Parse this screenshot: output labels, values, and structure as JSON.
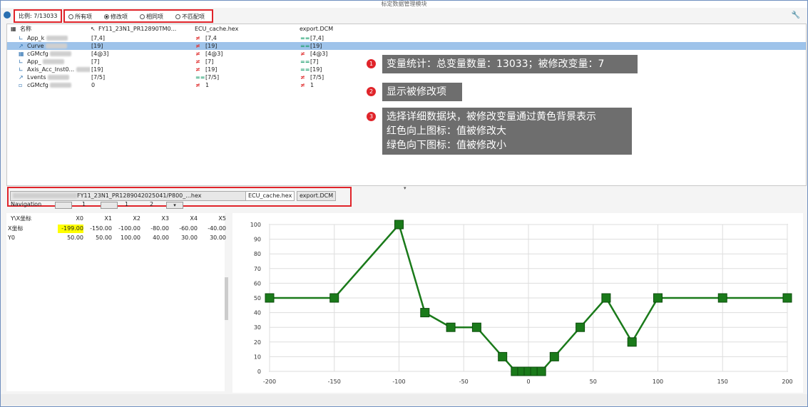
{
  "window": {
    "title": "标定数据管理模块"
  },
  "toolbar": {
    "ratio": "比例: 7/13033",
    "filters": [
      {
        "label": "所有项",
        "selected": false
      },
      {
        "label": "修改项",
        "selected": true
      },
      {
        "label": "相同项",
        "selected": false
      },
      {
        "label": "不匹配项",
        "selected": false
      }
    ],
    "settings_icon": "wrench-icon"
  },
  "tree": {
    "headers": [
      "名称",
      "FY11_23N1_PR12890TM0...",
      "ECU_cache.hex",
      "export.DCM"
    ],
    "rows": [
      {
        "icon": "axis-icon",
        "name": "App_k",
        "a": "[7,4]",
        "cmp1": "≠",
        "b": "[7,4",
        "cmp2": "==",
        "c": "[7,4]",
        "selected": false
      },
      {
        "icon": "curve-icon",
        "name": "Curve",
        "a": "[19]",
        "cmp1": "≠",
        "b": "[19]",
        "cmp2": "==",
        "c": "[19]",
        "selected": true
      },
      {
        "icon": "map-icon",
        "name": "cGMcfg",
        "a": "[4@3]",
        "cmp1": "≠",
        "b": "[4@3]",
        "cmp2": "≠",
        "c": "[4@3]",
        "selected": false
      },
      {
        "icon": "axis-icon",
        "name": "App_",
        "a": "[7]",
        "cmp1": "≠",
        "b": "[7]",
        "cmp2": "==",
        "c": "[7]",
        "selected": false
      },
      {
        "icon": "axis-icon",
        "name": "Axis_Acc_Inst0...",
        "a": "[19]",
        "cmp1": "≠",
        "b": "[19]",
        "cmp2": "==",
        "c": "[19]",
        "selected": false
      },
      {
        "icon": "curve-icon",
        "name": "Lvents",
        "a": "[7/5]",
        "cmp1": "==",
        "b": "[7/5]",
        "cmp2": "≠",
        "c": "[7/5]",
        "selected": false
      },
      {
        "icon": "value-icon",
        "name": "cGMcfg",
        "a": "0",
        "cmp1": "≠",
        "b": "1",
        "cmp2": "≠",
        "c": "1",
        "selected": false
      }
    ]
  },
  "callouts": [
    {
      "num": "1",
      "lines": [
        "变量统计：总变量数量：13033；被修改变量：7"
      ]
    },
    {
      "num": "2",
      "lines": [
        "显示被修改项"
      ]
    },
    {
      "num": "3",
      "lines": [
        "选择详细数据块，被修改变量通过黄色背景表示",
        "红色向上图标：值被修改大",
        "绿色向下图标：值被修改小"
      ]
    }
  ],
  "tabs": [
    {
      "label": "FY11_23N1_PR1289042025041/P800_...hex",
      "active": false
    },
    {
      "label": "ECU_cache.hex",
      "active": true
    },
    {
      "label": "export.DCM",
      "active": false
    }
  ],
  "nav": {
    "label": "Navigation",
    "values": [
      "1",
      "1",
      "1",
      "2"
    ]
  },
  "grid": {
    "headers": [
      "X\\Y",
      "X0",
      "X1",
      "X2",
      "X3",
      "X4",
      "X5"
    ],
    "corner_label": "Y\\X坐标",
    "rows": [
      {
        "label": "X坐标",
        "values": [
          "-199.00",
          "-150.00",
          "-100.00",
          "-80.00",
          "-60.00",
          "-40.00"
        ],
        "highlight": [
          true,
          false,
          false,
          false,
          false,
          false
        ]
      },
      {
        "label": "Y0",
        "values": [
          "50.00",
          "50.00",
          "100.00",
          "40.00",
          "30.00",
          "30.00"
        ],
        "highlight": [
          false,
          false,
          false,
          false,
          false,
          false
        ]
      }
    ]
  },
  "chart_data": {
    "type": "line",
    "x": [
      -200,
      -150,
      -100,
      -80,
      -60,
      -40,
      -20,
      -10,
      -5,
      0,
      5,
      10,
      20,
      40,
      60,
      80,
      100,
      150,
      200
    ],
    "series": [
      {
        "values": [
          50,
          50,
          100,
          40,
          30,
          30,
          10,
          0,
          0,
          0,
          0,
          0,
          10,
          30,
          50,
          20,
          50,
          50,
          50
        ],
        "color": "#1a7a1a"
      }
    ],
    "xlim": [
      -200,
      200
    ],
    "ylim": [
      0,
      100
    ],
    "xticks": [
      "-200",
      "-150",
      "-100",
      "-50",
      "0",
      "50",
      "100",
      "150",
      "200"
    ],
    "yticks": [
      "0",
      "10",
      "20",
      "30",
      "40",
      "50",
      "60",
      "70",
      "80",
      "90",
      "100"
    ],
    "grid": true
  }
}
